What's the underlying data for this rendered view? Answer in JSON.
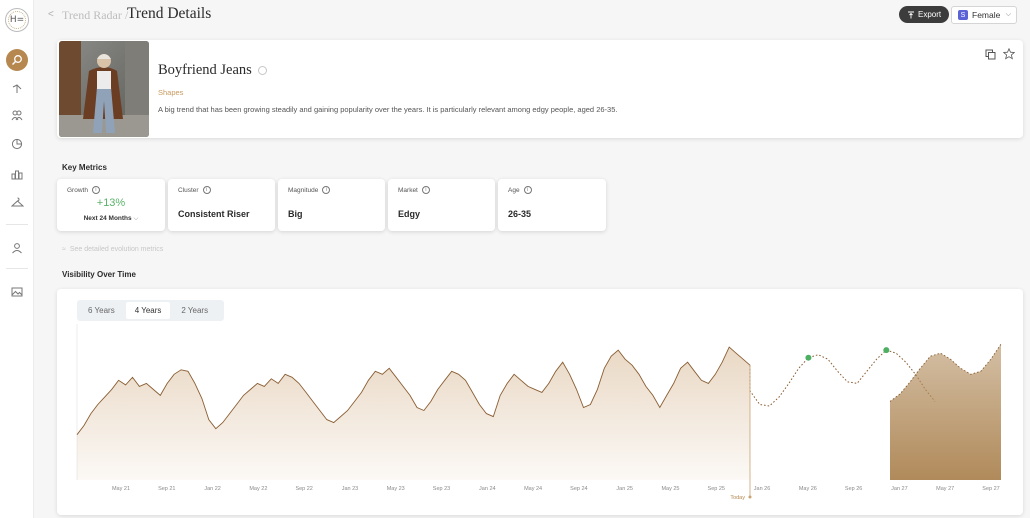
{
  "logo": {
    "text": "H="
  },
  "sidebar": {
    "icons": [
      "search-icon",
      "trend-icon",
      "people-icon",
      "pie-chart-icon",
      "analytics-icon",
      "hanger-icon",
      "user-icon",
      "gallery-icon"
    ]
  },
  "header": {
    "back": "<",
    "breadcrumb_parent": "Trend Radar /",
    "breadcrumb_current": "Trend Details",
    "export_label": "Export",
    "gender_badge": "S",
    "gender_value": "Female"
  },
  "trend": {
    "name": "Boyfriend Jeans",
    "category": "Shapes",
    "description": "A big trend that has been growing steadily and gaining popularity over the years. It is particularly relevant among edgy people, aged 26-35."
  },
  "metrics": {
    "section_title": "Key Metrics",
    "growth": {
      "label": "Growth",
      "value": "+13%",
      "period": "Next 24 Months"
    },
    "cluster": {
      "label": "Cluster",
      "value": "Consistent Riser"
    },
    "magnitude": {
      "label": "Magnitude",
      "value": "Big"
    },
    "market": {
      "label": "Market",
      "value": "Edgy"
    },
    "age": {
      "label": "Age",
      "value": "26-35"
    },
    "see_more": "See detailed evolution metrics"
  },
  "visibility": {
    "section_title": "Visibility Over Time",
    "ranges": [
      "6 Years",
      "4 Years",
      "2 Years"
    ],
    "selected_range": "4 Years"
  },
  "colors": {
    "accent": "#b6884f",
    "growth": "#5bb36a",
    "marker": "#4caf62",
    "area": "#e8d6c1",
    "forecast_band": "#b08a5a"
  },
  "chart_data": {
    "type": "area",
    "x_ticks": [
      "May 21",
      "Sep 21",
      "Jan 22",
      "May 22",
      "Sep 22",
      "Jan 23",
      "May 23",
      "Sep 23",
      "Jan 24",
      "May 24",
      "Sep 24",
      "Jan 25",
      "May 25",
      "Sep 25",
      "Jan 26",
      "May 26",
      "Sep 26",
      "Jan 27",
      "May 27",
      "Sep 27"
    ],
    "today_label": "Today",
    "ylim": [
      0,
      100
    ],
    "series": [
      {
        "values": [
          30,
          36,
          44,
          50,
          55,
          60,
          66,
          63,
          68,
          62,
          64,
          60,
          56,
          64,
          70,
          73,
          72,
          64,
          54,
          40,
          34,
          38,
          44,
          50,
          56,
          60,
          64,
          62,
          67,
          64,
          70,
          68,
          64,
          58,
          52,
          46,
          40,
          38,
          42,
          46,
          52,
          58,
          66,
          72,
          70,
          74,
          68,
          62,
          56,
          48,
          46,
          52,
          60,
          66,
          72,
          70,
          66,
          58,
          50,
          44,
          42,
          56,
          64,
          70,
          66,
          62,
          60,
          58,
          64,
          72,
          78,
          70,
          60,
          48,
          50,
          60,
          74,
          82,
          86,
          80,
          76,
          70,
          62,
          56,
          48,
          56,
          64,
          74,
          78,
          72,
          66,
          64,
          70,
          78,
          88,
          84,
          80,
          76
        ]
      },
      {
        "values": [
          59,
          50,
          49,
          55,
          64,
          74,
          81,
          83,
          80,
          72,
          65,
          64,
          72,
          80,
          86,
          84,
          78,
          70,
          60,
          52
        ]
      },
      {
        "values": [
          52,
          57,
          65,
          74,
          82,
          84,
          80,
          74,
          70,
          72,
          80,
          90
        ]
      }
    ]
  }
}
